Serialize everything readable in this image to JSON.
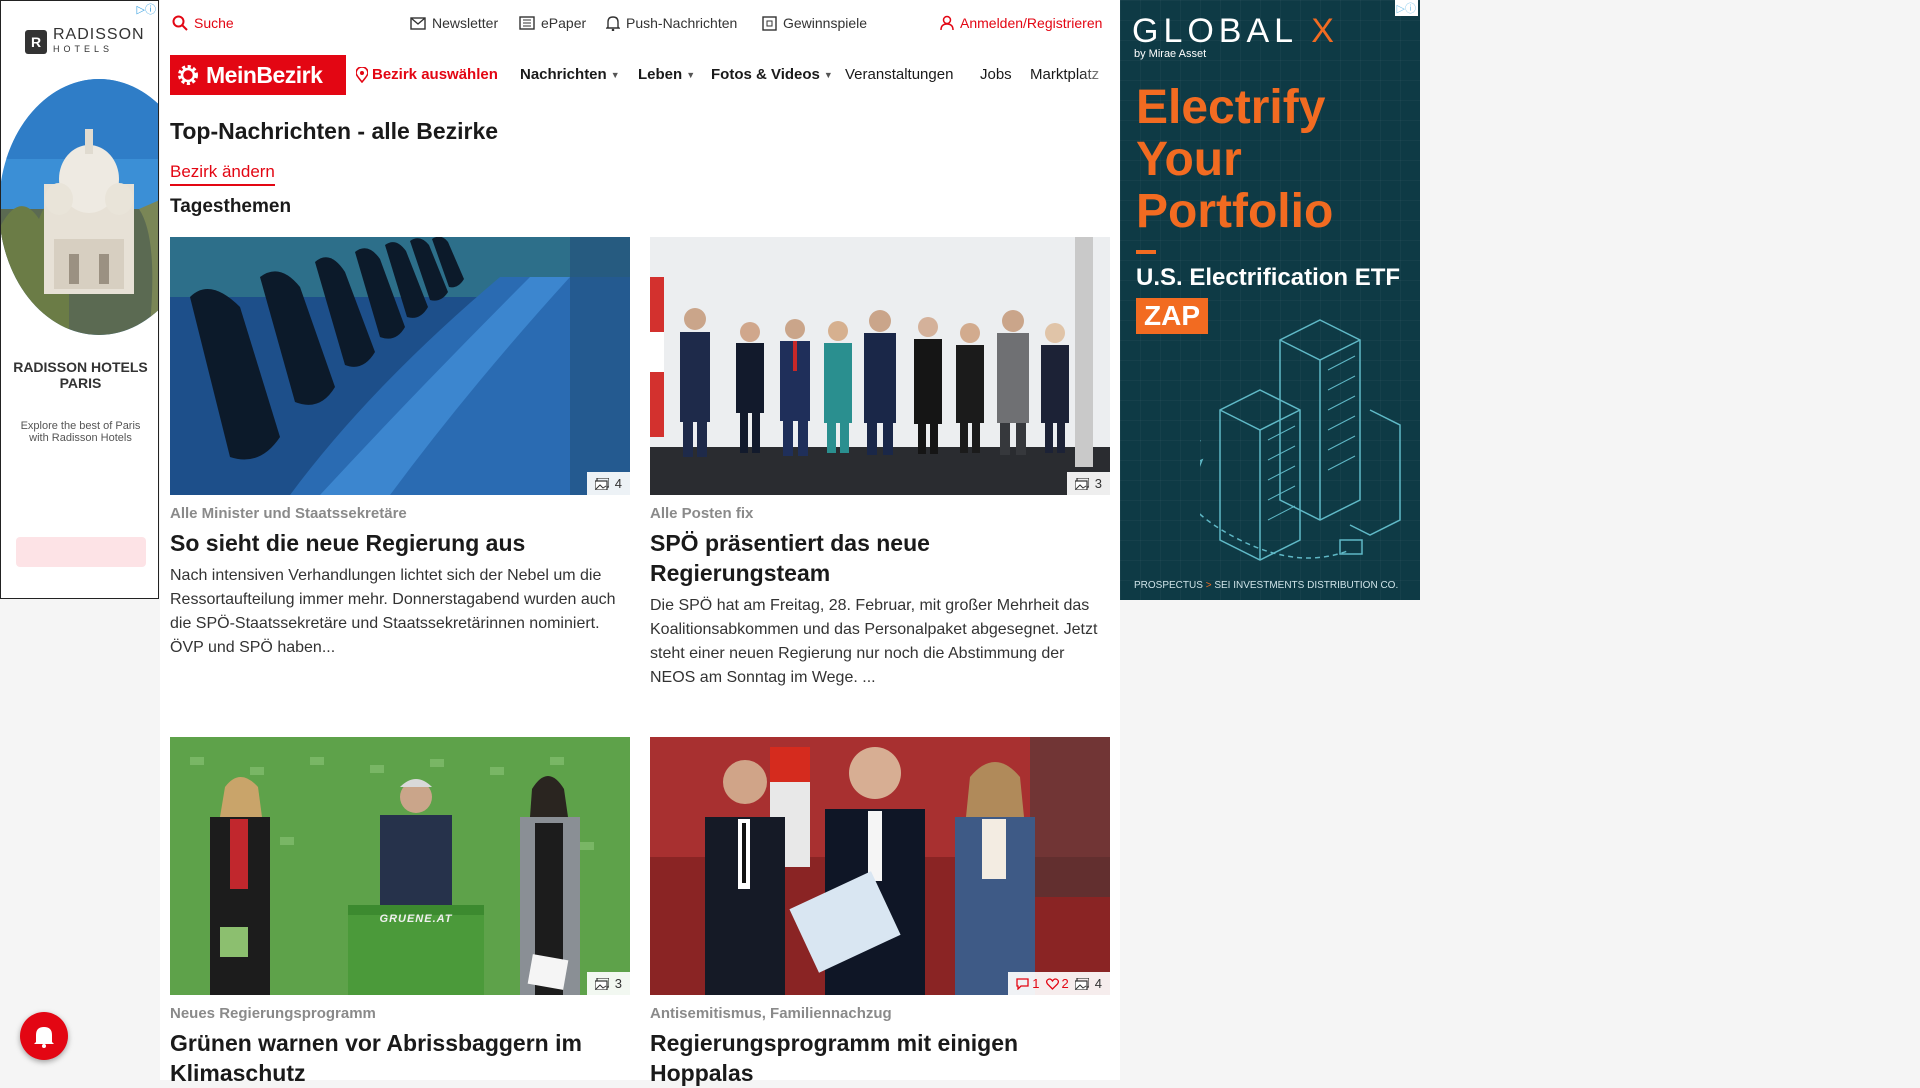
{
  "ad_left": {
    "choice": "▷ⓘ",
    "brand_mark": "R",
    "brand_name": "RADISSON",
    "brand_sub": "HOTELS",
    "headline": "RADISSON HOTELS PARIS",
    "subtext": "Explore the best of Paris with Radisson Hotels"
  },
  "util": {
    "search": "Suche",
    "newsletter": "Newsletter",
    "epaper": "ePaper",
    "push": "Push-Nachrichten",
    "gewinnspiele": "Gewinnspiele",
    "login": "Anmelden/Registrieren"
  },
  "nav": {
    "brand": "MeinBezirk",
    "bezirk": "Bezirk auswählen",
    "nachrichten": "Nachrichten",
    "leben": "Leben",
    "fotos": "Fotos & Videos",
    "veranstaltungen": "Veranstaltungen",
    "jobs": "Jobs",
    "marktplatz": "Marktplatz"
  },
  "page": {
    "title": "Top-Nachrichten - alle Bezirke",
    "change_link": "Bezirk ändern",
    "section": "Tagesthemen"
  },
  "articles": [
    {
      "kicker": "Alle Minister und Staatssekretäre",
      "headline": "So sieht die neue Regierung aus",
      "teaser": "Nach intensiven Verhandlungen lichtet sich der Nebel um die Ressortaufteilung immer mehr. Donnerstagabend wurden auch die SPÖ-Staatssekretäre und Staatssekretärinnen nominiert. ÖVP und SPÖ haben...",
      "photos": "4"
    },
    {
      "kicker": "Alle Posten fix",
      "headline": "SPÖ präsentiert das neue Regierungsteam",
      "teaser": "Die SPÖ hat am Freitag, 28. Februar, mit großer Mehrheit das Koalitionsabkommen und das Personalpaket abgesegnet. Jetzt steht einer neuen Regierung nur noch die Abstimmung der NEOS am Sonntag im Wege. ...",
      "photos": "3"
    },
    {
      "kicker": "Neues Regierungsprogramm",
      "headline": "Grünen warnen vor Abrissbaggern im Klimaschutz",
      "photos": "3",
      "podium_text": "GRUENE.AT"
    },
    {
      "kicker": "Antisemitismus, Familiennachzug",
      "headline": "Regierungsprogramm mit einigen Hoppalas",
      "comments": "1",
      "likes": "2",
      "photos": "4"
    }
  ],
  "ad_right": {
    "choice": "▷ⓘ",
    "brand": "GLOBAL",
    "brand_x": "X",
    "by": "by Mirae Asset",
    "headline_1": "Electrify",
    "headline_2": "Your",
    "headline_3": "Portfolio",
    "etf": "U.S. Electrification ETF",
    "ticker": "ZAP",
    "footer_link": "PROSPECTUS",
    "footer_arrow": ">",
    "footer_text": "SEI INVESTMENTS DISTRIBUTION CO."
  },
  "colors": {
    "brand_red": "#e30613",
    "ad_teal": "#0e3a45",
    "ad_orange": "#f26b21"
  }
}
